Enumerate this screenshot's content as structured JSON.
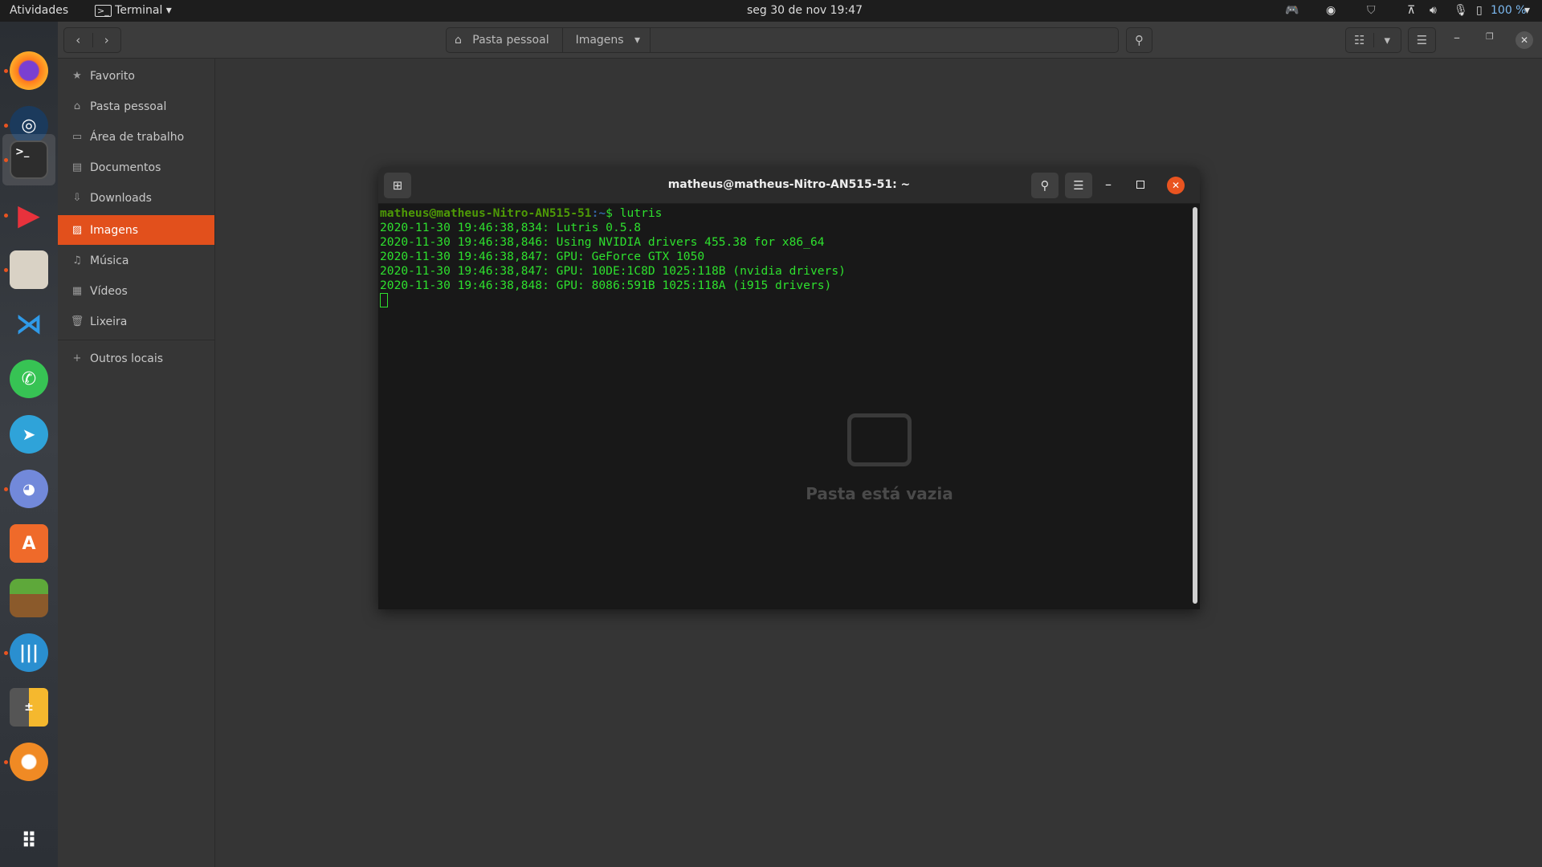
{
  "topbar": {
    "activities": "Atividades",
    "app_menu": "Terminal",
    "clock": "seg 30 de nov  19:47",
    "battery": "100 %"
  },
  "dock": {
    "apps": [
      "firefox",
      "steam",
      "terminal",
      "flow",
      "files",
      "vscode",
      "whatsapp",
      "telegram",
      "discord",
      "software-center",
      "minecraft",
      "mixer",
      "calculator",
      "blender",
      "show-applications"
    ]
  },
  "nautilus": {
    "path": [
      "Pasta pessoal",
      "Imagens"
    ],
    "sidebar": [
      {
        "label": "Favorito",
        "icon": "star-icon"
      },
      {
        "label": "Pasta pessoal",
        "icon": "home-icon"
      },
      {
        "label": "Área de trabalho",
        "icon": "desktop-icon"
      },
      {
        "label": "Documentos",
        "icon": "document-icon"
      },
      {
        "label": "Downloads",
        "icon": "download-icon"
      },
      {
        "label": "Imagens",
        "icon": "image-icon",
        "active": true
      },
      {
        "label": "Música",
        "icon": "music-icon"
      },
      {
        "label": "Vídeos",
        "icon": "video-icon"
      },
      {
        "label": "Lixeira",
        "icon": "trash-icon"
      }
    ],
    "other_locations": "Outros locais",
    "empty_text": "Pasta está vazia",
    "accent": "#e2501c"
  },
  "terminal": {
    "title": "matheus@matheus-Nitro-AN515-51: ~",
    "prompt_user": "matheus@matheus-Nitro-AN515-51",
    "prompt_path": ":~",
    "prompt_cmd": "$ lutris",
    "lines": [
      "2020-11-30 19:46:38,834: Lutris 0.5.8",
      "2020-11-30 19:46:38,846: Using NVIDIA drivers 455.38 for x86_64",
      "2020-11-30 19:46:38,847: GPU: GeForce GTX 1050",
      "2020-11-30 19:46:38,847: GPU: 10DE:1C8D 1025:118B (nvidia drivers)",
      "2020-11-30 19:46:38,848: GPU: 8086:591B 1025:118A (i915 drivers)"
    ],
    "text_color": "#2ee02e"
  }
}
